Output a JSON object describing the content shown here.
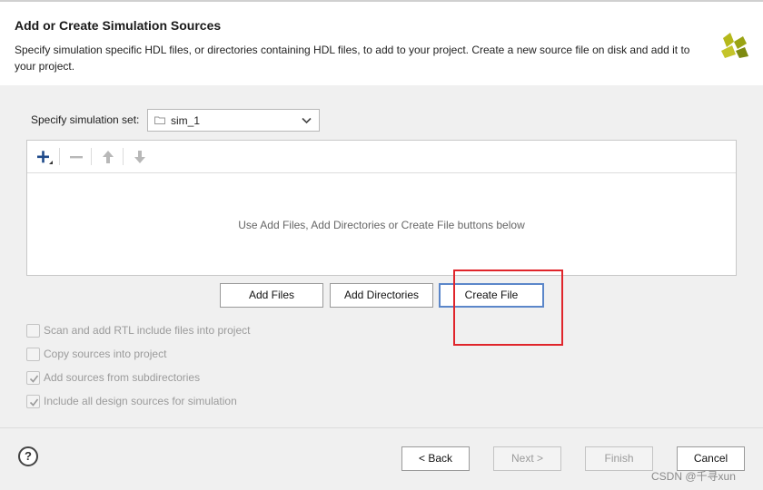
{
  "header": {
    "title": "Add or Create Simulation Sources",
    "description": "Specify simulation specific HDL files, or directories containing HDL files, to add to your project. Create a new source file on disk and add it to your project.",
    "logo_colors": [
      "#b5b81a",
      "#7d8a10"
    ]
  },
  "simset": {
    "label": "Specify simulation set:",
    "value": "sim_1"
  },
  "panel": {
    "toolbar": {
      "add_icon": "plus-icon",
      "remove_icon": "minus-icon",
      "up_icon": "arrow-up-icon",
      "down_icon": "arrow-down-icon"
    },
    "empty_message": "Use Add Files, Add Directories or Create File buttons below"
  },
  "buttons": {
    "add_files": "Add Files",
    "add_directories": "Add Directories",
    "create_file": "Create File"
  },
  "options": [
    {
      "label": "Scan and add RTL include files into project",
      "checked": false
    },
    {
      "label": "Copy sources into project",
      "checked": false
    },
    {
      "label": "Add sources from subdirectories",
      "checked": true
    },
    {
      "label": "Include all design sources for simulation",
      "checked": true
    }
  ],
  "footer": {
    "help": "?",
    "back": "< Back",
    "next": "Next >",
    "finish": "Finish",
    "cancel": "Cancel"
  },
  "watermark": "CSDN @千寻xun",
  "colors": {
    "annotation": "#e0252b",
    "focus": "#5b86c9"
  }
}
